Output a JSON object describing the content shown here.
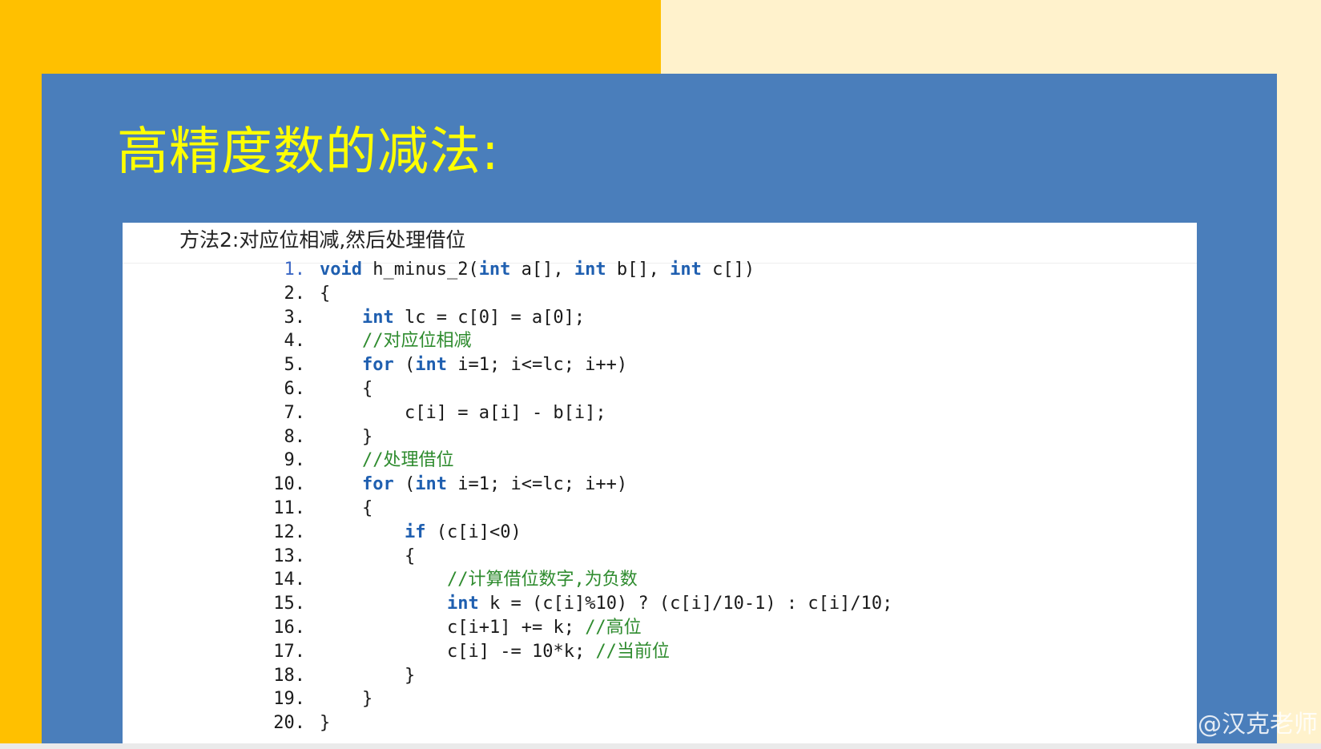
{
  "slide": {
    "title": "高精度数的减法:",
    "method_heading": "方法2:对应位相减,然后处理借位",
    "code_lines": [
      {
        "no": "1.",
        "indent": 0,
        "tokens": [
          {
            "t": "void",
            "k": "kw"
          },
          {
            "t": " h_minus_2("
          },
          {
            "t": "int",
            "k": "kw"
          },
          {
            "t": " a[], "
          },
          {
            "t": "int",
            "k": "kw"
          },
          {
            "t": " b[], "
          },
          {
            "t": "int",
            "k": "kw"
          },
          {
            "t": " c[])"
          }
        ]
      },
      {
        "no": "2.",
        "indent": 0,
        "tokens": [
          {
            "t": "{"
          }
        ]
      },
      {
        "no": "3.",
        "indent": 1,
        "tokens": [
          {
            "t": "int",
            "k": "kw"
          },
          {
            "t": " lc = c[0] = a[0];"
          }
        ]
      },
      {
        "no": "4.",
        "indent": 1,
        "tokens": [
          {
            "t": "//对应位相减",
            "k": "cm"
          }
        ]
      },
      {
        "no": "5.",
        "indent": 1,
        "tokens": [
          {
            "t": "for",
            "k": "kw"
          },
          {
            "t": " ("
          },
          {
            "t": "int",
            "k": "kw"
          },
          {
            "t": " i=1; i<=lc; i++)"
          }
        ]
      },
      {
        "no": "6.",
        "indent": 1,
        "tokens": [
          {
            "t": "{"
          }
        ]
      },
      {
        "no": "7.",
        "indent": 2,
        "tokens": [
          {
            "t": "c[i] = a[i] - b[i];"
          }
        ]
      },
      {
        "no": "8.",
        "indent": 1,
        "tokens": [
          {
            "t": "}"
          }
        ]
      },
      {
        "no": "9.",
        "indent": 1,
        "tokens": [
          {
            "t": "//处理借位",
            "k": "cm"
          }
        ]
      },
      {
        "no": "10.",
        "indent": 1,
        "tokens": [
          {
            "t": "for",
            "k": "kw"
          },
          {
            "t": " ("
          },
          {
            "t": "int",
            "k": "kw"
          },
          {
            "t": " i=1; i<=lc; i++)"
          }
        ]
      },
      {
        "no": "11.",
        "indent": 1,
        "tokens": [
          {
            "t": "{"
          }
        ]
      },
      {
        "no": "12.",
        "indent": 2,
        "tokens": [
          {
            "t": "if",
            "k": "kw"
          },
          {
            "t": " (c[i]<0)"
          }
        ]
      },
      {
        "no": "13.",
        "indent": 2,
        "tokens": [
          {
            "t": "{"
          }
        ]
      },
      {
        "no": "14.",
        "indent": 3,
        "tokens": [
          {
            "t": "//计算借位数字,为负数",
            "k": "cm"
          }
        ]
      },
      {
        "no": "15.",
        "indent": 3,
        "tokens": [
          {
            "t": "int",
            "k": "kw"
          },
          {
            "t": " k = (c[i]%10) ? (c[i]/10-1) : c[i]/10;"
          }
        ]
      },
      {
        "no": "16.",
        "indent": 3,
        "tokens": [
          {
            "t": "c[i+1] += k; "
          },
          {
            "t": "//高位",
            "k": "cm"
          }
        ]
      },
      {
        "no": "17.",
        "indent": 3,
        "tokens": [
          {
            "t": "c[i] -= 10*k; "
          },
          {
            "t": "//当前位",
            "k": "cm"
          }
        ]
      },
      {
        "no": "18.",
        "indent": 2,
        "tokens": [
          {
            "t": "}"
          }
        ]
      },
      {
        "no": "19.",
        "indent": 1,
        "tokens": [
          {
            "t": "}"
          }
        ]
      },
      {
        "no": "20.",
        "indent": 0,
        "tokens": [
          {
            "t": "}"
          }
        ]
      }
    ]
  },
  "watermark": "CSDN @汉克老师",
  "colors": {
    "background_left": "#FFC000",
    "background_right": "#FFF2CC",
    "panel": "#4A7EBB",
    "title": "#FFFF00",
    "keyword": "#1f5fb0",
    "comment": "#2e8b2e"
  }
}
